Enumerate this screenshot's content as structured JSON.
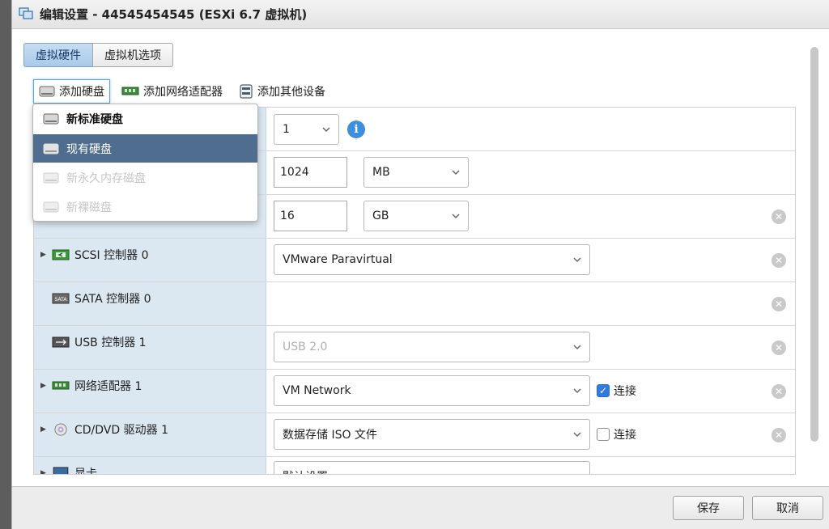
{
  "window": {
    "title": "编辑设置 - 44545454545 (ESXi 6.7 虚拟机)"
  },
  "tabs": [
    {
      "label": "虚拟硬件",
      "active": true
    },
    {
      "label": "虚拟机选项",
      "active": false
    }
  ],
  "toolbar": {
    "add_disk": "添加硬盘",
    "add_network": "添加网络适配器",
    "add_other": "添加其他设备"
  },
  "disk_menu": {
    "items": [
      {
        "label": "新标准硬盘",
        "icon": "disk-icon",
        "state": "normal"
      },
      {
        "label": "现有硬盘",
        "icon": "disk-icon",
        "state": "selected"
      },
      {
        "label": "新永久内存磁盘",
        "icon": "disk-icon",
        "state": "disabled"
      },
      {
        "label": "新裸磁盘",
        "icon": "disk-icon",
        "state": "disabled"
      }
    ]
  },
  "rows": {
    "cpu": {
      "value": "1"
    },
    "memory": {
      "value": "1024",
      "unit": "MB"
    },
    "disk": {
      "value": "16",
      "unit": "GB"
    },
    "scsi": {
      "label": "SCSI 控制器 0",
      "value": "VMware Paravirtual"
    },
    "sata": {
      "label": "SATA 控制器 0"
    },
    "usb": {
      "label": "USB 控制器 1",
      "value": "USB 2.0"
    },
    "network": {
      "label": "网络适配器 1",
      "value": "VM Network",
      "connect_label": "连接",
      "connected": true
    },
    "cddvd": {
      "label": "CD/DVD 驱动器 1",
      "value": "数据存储 ISO 文件",
      "connect_label": "连接",
      "connected": false
    },
    "video": {
      "label": "显卡",
      "value": "默认设置"
    }
  },
  "footer": {
    "save": "保存",
    "cancel": "取消"
  },
  "colors": {
    "accent": "#2f7ae5",
    "label_bg": "#dbe8f2",
    "selected_menu": "#4f6d8f"
  }
}
